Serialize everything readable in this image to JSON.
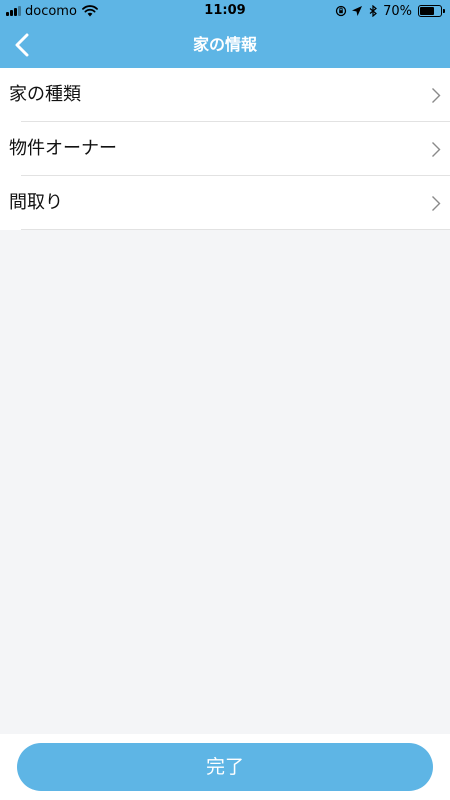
{
  "status_bar": {
    "carrier": "docomo",
    "time": "11:09",
    "battery_percent": "70%",
    "battery_level": 0.7,
    "icons": [
      "signal-icon",
      "wifi-icon",
      "orientation-lock-icon",
      "location-icon",
      "bluetooth-icon",
      "battery-icon"
    ]
  },
  "nav": {
    "title": "家の情報",
    "back_icon": "chevron-left-icon"
  },
  "list": {
    "items": [
      {
        "label": "家の種類",
        "icon": "chevron-right-icon"
      },
      {
        "label": "物件オーナー",
        "icon": "chevron-right-icon"
      },
      {
        "label": "間取り",
        "icon": "chevron-right-icon"
      }
    ]
  },
  "footer": {
    "done_label": "完了"
  },
  "colors": {
    "primary": "#5eb5e5",
    "background": "#f4f5f7",
    "divider": "#e2e2e2",
    "text": "#111111"
  }
}
